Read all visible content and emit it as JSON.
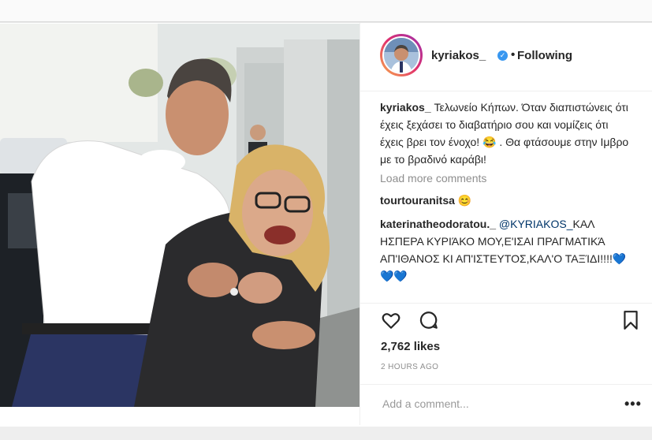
{
  "post": {
    "username": "kyriakos_",
    "follow_status": "Following",
    "caption_user": "kyriakos_",
    "caption_text": "Τελωνείο Κήπων. Όταν διαπιστώνεις ότι έχεις ξεχάσει το διαβατήριο σου και νομίζεις ότι έχεις βρει τον ένοχο! 😂 . Θα φτάσουμε στην Ιμβρο με το βραδινό καράβι!",
    "load_more": "Load more comments",
    "comments": [
      {
        "user": "tourtouranitsa",
        "mention": "",
        "text": "😊"
      },
      {
        "user": "katerinatheodoratou._",
        "mention": "@KYRIAKOS_",
        "text": "ΚΑΛ ΗΣΠΕΡΑ ΚΥΡΙΆΚΟ ΜΟΥ,Ε'ΙΣΑΙ ΠΡΑΓΜΑΤΙΚΆ ΑΠ'ΙΘΑΝΟΣ ΚΙ ΑΠ'ΙΣΤΕΥΤΟΣ,ΚΑΛ'Ο ΤΑΞΊΔΙ!!!!💙💙💙"
      }
    ],
    "likes": "2,762 likes",
    "time": "2 HOURS AGO",
    "add_comment_placeholder": "Add a comment...",
    "more_label": "•••"
  },
  "icons": {
    "verified": "verified-badge-icon",
    "like": "heart-icon",
    "comment": "comment-icon",
    "save": "bookmark-icon",
    "more": "more-options-icon"
  },
  "colors": {
    "link": "#003569",
    "verified": "#3897f0",
    "muted": "#8e8e8e"
  }
}
